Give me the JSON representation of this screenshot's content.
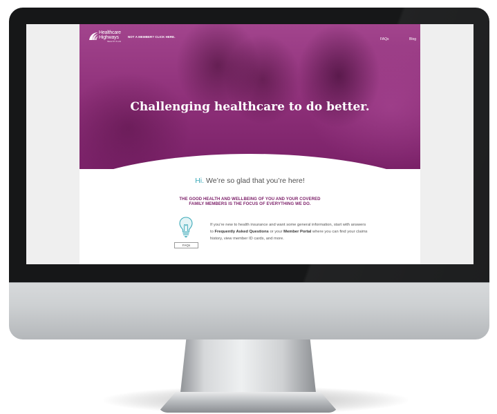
{
  "site": {
    "logo": {
      "line1": "Healthcare",
      "line2": "Highways",
      "sub": "HEALTH PLAN"
    },
    "member_link": "NOT A MEMBER? CLICK HERE.",
    "nav": [
      {
        "label": "FAQs"
      },
      {
        "label": "Blog"
      }
    ]
  },
  "hero": {
    "headline": "Challenging healthcare to do better."
  },
  "intro": {
    "hi": "Hi.",
    "greeting": " We’re so glad that you’re here!",
    "focus_line1": "THE GOOD HEALTH AND WELLBEING OF YOU AND YOUR COVERED",
    "focus_line2": "FAMILY MEMBERS IS THE FOCUS OF EVERYTHING WE DO."
  },
  "faqs_block": {
    "button_label": "FAQs",
    "text_1": "If you’re new to health insurance and want some general information, start with answers to ",
    "bold_1": "Frequently Asked Questions",
    "text_2": " or your ",
    "bold_2": "Member Portal",
    "text_3": " where you can find your claims history, view member ID cards, and more."
  },
  "colors": {
    "brand_purple": "#8d2f78",
    "accent_teal": "#3ba9b8",
    "focus_text": "#7a1b66"
  },
  "icons": [
    "logo-mark-icon",
    "lightbulb-icon"
  ]
}
